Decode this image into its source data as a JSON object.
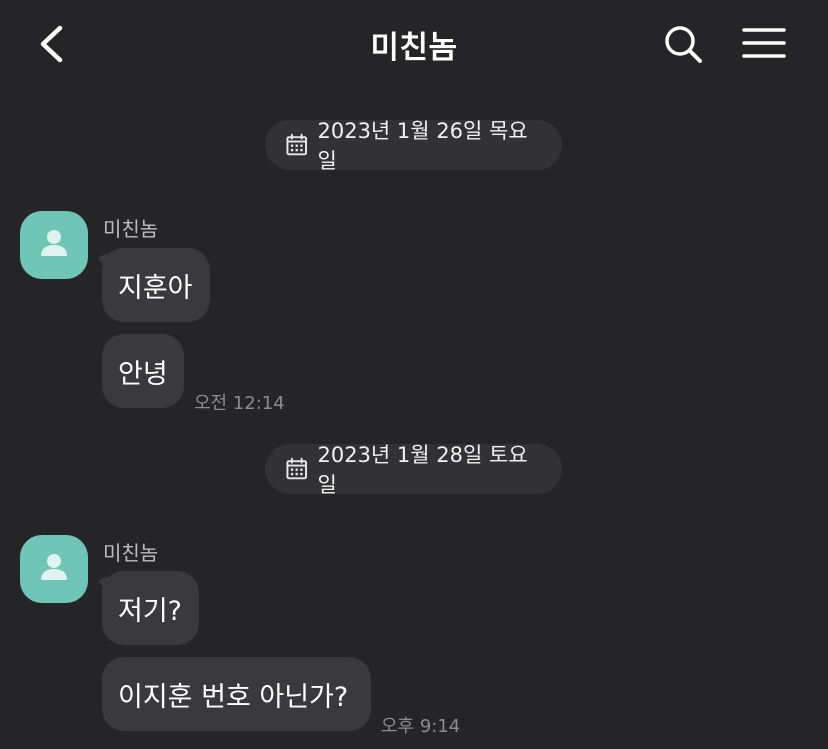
{
  "header": {
    "title": "미친놈",
    "back_icon": "chevron-left-icon",
    "search_icon": "search-icon",
    "menu_icon": "hamburger-menu-icon"
  },
  "colors": {
    "background": "#252427",
    "bubble": "#3a393d",
    "date_chip": "#323135",
    "avatar": "#6fc6b6",
    "timestamp": "#8c8c8f"
  },
  "messages": [
    {
      "date": "2023년 1월 26일 목요일",
      "sender": "미친놈",
      "bubbles": [
        "지훈아",
        "안녕"
      ],
      "time": "오전 12:14"
    },
    {
      "date": "2023년 1월 28일 토요일",
      "sender": "미친놈",
      "bubbles": [
        "저기?",
        "이지훈 번호 아닌가?"
      ],
      "time": "오후 9:14"
    }
  ]
}
